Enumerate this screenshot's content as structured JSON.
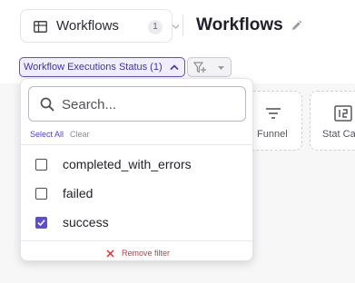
{
  "header": {
    "view_selector": {
      "label": "Workflows",
      "count": "1",
      "icon": "table-icon"
    },
    "page_title": "Workflows"
  },
  "filters": {
    "active_chip_label": "Workflow Executions Status (1)",
    "add_filter_icon": "filter-plus-icon"
  },
  "cards": [
    {
      "label": "Funnel",
      "icon": "funnel-icon"
    },
    {
      "label": "Stat Ca",
      "icon": "stat-card-icon"
    }
  ],
  "dropdown": {
    "search_placeholder": "Search...",
    "search_value": "",
    "select_all": "Select All",
    "clear": "Clear",
    "options": [
      {
        "label": "completed_with_errors",
        "checked": false
      },
      {
        "label": "failed",
        "checked": false
      },
      {
        "label": "success",
        "checked": true
      }
    ],
    "remove_filter": "Remove filter"
  },
  "colors": {
    "accent": "#5b4dd8",
    "danger": "#d0343a",
    "background": "#f7f7f8"
  }
}
